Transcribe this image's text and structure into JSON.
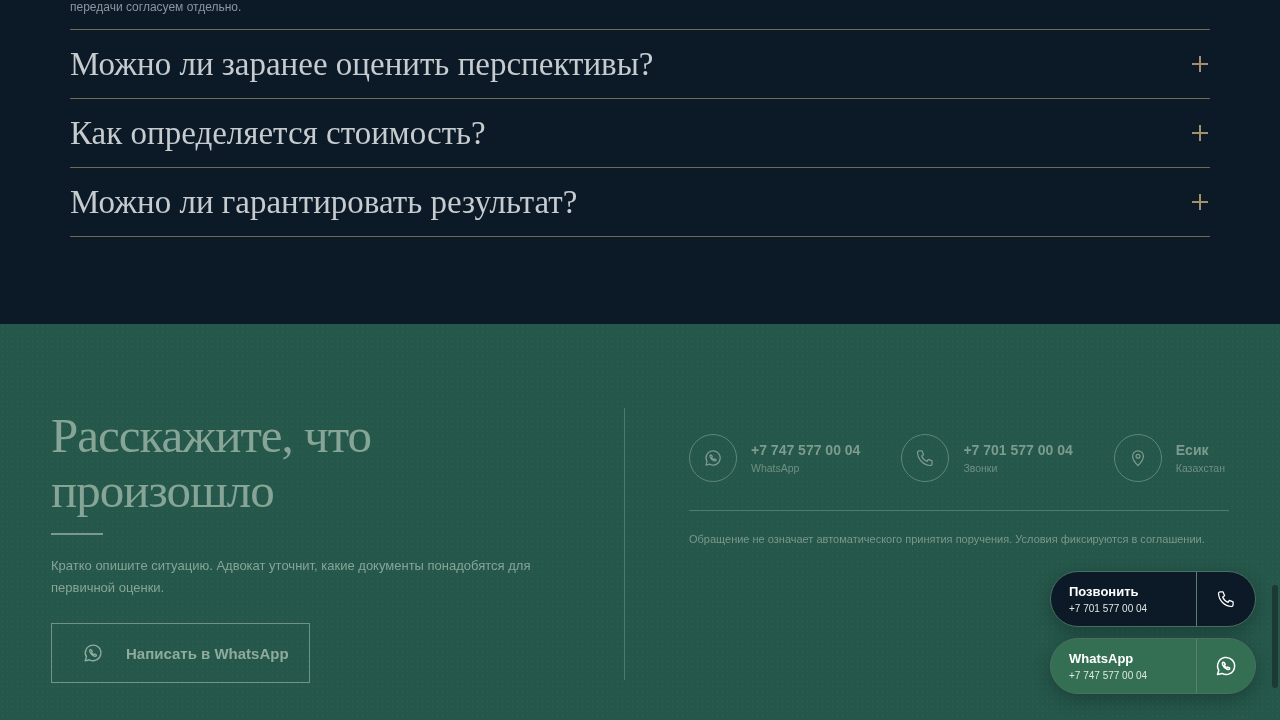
{
  "faq": {
    "cut_text": "передачи согласуем отдельно.",
    "items": [
      {
        "question": "Можно ли заранее оценить перспективы?",
        "expanded": false
      },
      {
        "question": "Как определяется стоимость?",
        "expanded": false
      },
      {
        "question": "Можно ли гарантировать результат?",
        "expanded": false
      }
    ]
  },
  "contact": {
    "title": "Расскажите, что произошло",
    "text": "Кратко опишите ситуацию. Адвокат уточнит, какие документы понадобятся для первичной оценки.",
    "button": "Написать в WhatsApp",
    "channels": [
      {
        "kind": "whatsapp",
        "value": "+7 747 577 00 04",
        "caption": "WhatsApp"
      },
      {
        "kind": "phone",
        "value": "+7 701 577 00 04",
        "caption": "Звонки"
      },
      {
        "kind": "location",
        "value": "Есик",
        "caption": "Казахстан"
      }
    ],
    "note": "Обращение не означает автоматического принятия поручения. Условия фиксируются в соглашении."
  },
  "floating_buttons": [
    {
      "kind": "phone",
      "label": "Позвонить",
      "number": "+7 701 577 00 04"
    },
    {
      "kind": "whatsapp",
      "label": "WhatsApp",
      "number": "+7 747 577 00 04"
    }
  ]
}
